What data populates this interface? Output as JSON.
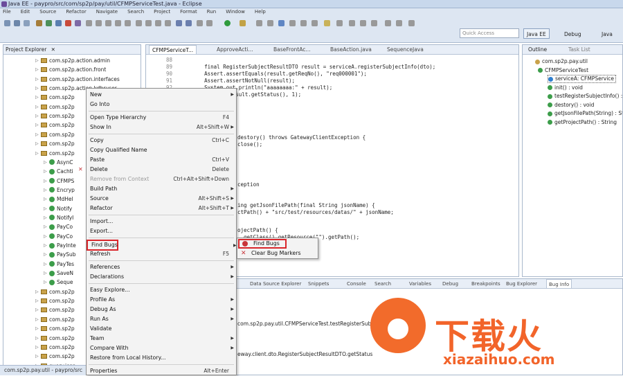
{
  "window": {
    "title": "Java EE - paypro/src/com/sp2p/pay/util/CFMPServiceTest.java - Eclipse"
  },
  "menubar": [
    "File",
    "Edit",
    "Source",
    "Refactor",
    "Navigate",
    "Search",
    "Project",
    "Format",
    "Run",
    "Window",
    "Help"
  ],
  "toolbar": {
    "quick_access_placeholder": "Quick Access",
    "perspectives": [
      "Java EE",
      "Debug",
      "Java"
    ]
  },
  "project_explorer": {
    "title": "Project Explorer",
    "items": [
      {
        "label": "com.sp2p.action.admin",
        "type": "package"
      },
      {
        "label": "com.sp2p.action.front",
        "type": "package"
      },
      {
        "label": "com.sp2p.action.interfaces",
        "type": "package"
      },
      {
        "label": "com.sp2p.action.kdbruser",
        "type": "package"
      },
      {
        "label": "com.sp2p",
        "type": "package"
      },
      {
        "label": "com.sp2p",
        "type": "package"
      },
      {
        "label": "com.sp2p",
        "type": "package"
      },
      {
        "label": "com.sp2p",
        "type": "package"
      },
      {
        "label": "com.sp2p",
        "type": "package"
      },
      {
        "label": "com.sp2p",
        "type": "package"
      },
      {
        "label": "com.sp2p",
        "type": "package"
      },
      {
        "label": "AsynC",
        "type": "class"
      },
      {
        "label": "Cachti",
        "type": "class"
      },
      {
        "label": "CFMPS",
        "type": "class"
      },
      {
        "label": "Encryp",
        "type": "class"
      },
      {
        "label": "MdHel",
        "type": "class"
      },
      {
        "label": "Notify",
        "type": "class"
      },
      {
        "label": "NotifyI",
        "type": "class"
      },
      {
        "label": "PayCo",
        "type": "class"
      },
      {
        "label": "PayCo",
        "type": "class"
      },
      {
        "label": "PayInte",
        "type": "class"
      },
      {
        "label": "PaySub",
        "type": "class"
      },
      {
        "label": "PayTes",
        "type": "class"
      },
      {
        "label": "SaveN",
        "type": "class"
      },
      {
        "label": "Seque",
        "type": "class"
      },
      {
        "label": "com.sp2p",
        "type": "package"
      },
      {
        "label": "com.sp2p",
        "type": "package"
      },
      {
        "label": "com.sp2p",
        "type": "package"
      },
      {
        "label": "com.sp2p",
        "type": "package"
      },
      {
        "label": "com.sp2p",
        "type": "package"
      },
      {
        "label": "com.sp2p",
        "type": "package"
      },
      {
        "label": "com.sp2p",
        "type": "package"
      },
      {
        "label": "com.sp2p",
        "type": "package"
      },
      {
        "label": "query.icgs",
        "type": "package"
      },
      {
        "label": "com.sp2p",
        "type": "package"
      }
    ]
  },
  "editor": {
    "tabs": [
      "CFMPServiceT...",
      "ApproveActi...",
      "BaseFrontAc...",
      "BaseAction.java",
      "SequenceJava"
    ],
    "lines": [
      {
        "n": "88",
        "text": ""
      },
      {
        "n": "89",
        "text": "        final RegisterSubjectResultDTO result = serviceA.registerSubjectInfo(dto);"
      },
      {
        "n": "90",
        "text": "        Assert.assertEquals(result.getReqNo(), \"req000001\");"
      },
      {
        "n": "91",
        "text": "        Assert.assertNotNull(result);"
      },
      {
        "n": "92",
        "text": "        System.out.println(\"aaaaaaaa:\" + result);"
      },
      {
        "n": "",
        "text": "        ...uals(result.getStatus(), 1);"
      }
    ],
    "fragments": [
      "destory() throws GatewayClientException {",
      "close();",
      "",
      "ception",
      "ing getJsonFilePath(final String jsonName) {",
      "ctPath() + \"src/test/resources/datas/\" + jsonName;",
      "ojectPath() {",
      "  getClass().getResource(\"\").getPath();",
      "  (\"CFMPServiceTest\", \"\");"
    ]
  },
  "outline": {
    "tabs": [
      "Outline",
      "Task List"
    ],
    "items": [
      {
        "label": "com.sp2p.pay.util",
        "kind": "package"
      },
      {
        "label": "CFMPServiceTest",
        "kind": "class"
      },
      {
        "label": "serviceA: CFMPService",
        "kind": "field"
      },
      {
        "label": "init() : void",
        "kind": "method"
      },
      {
        "label": "testRegisterSubjectInfo() :",
        "kind": "method"
      },
      {
        "label": "destory() : void",
        "kind": "method"
      },
      {
        "label": "getJsonFilePath(String) : St",
        "kind": "method"
      },
      {
        "label": "getProjectPath() : String",
        "kind": "method"
      }
    ]
  },
  "bottom_panel": {
    "tabs": [
      "Data Source Explorer",
      "Snippets",
      "Console",
      "Search",
      "Variables",
      "Debug",
      "Breakpoints",
      "Bug Explorer",
      "Bug Info"
    ],
    "lines": [
      "com.sp2p.pay.util.CFMPServiceTest.testRegisterSubject",
      "",
      "eway.client.dto.RegisterSubjectResultDTO.getStatus"
    ]
  },
  "context_menu": {
    "items": [
      {
        "label": "New",
        "shortcut": "",
        "submenu": true
      },
      {
        "label": "Go Into",
        "shortcut": ""
      },
      {
        "sep": true
      },
      {
        "label": "Open Type Hierarchy",
        "shortcut": "F4"
      },
      {
        "label": "Show In",
        "shortcut": "Alt+Shift+W",
        "submenu": true
      },
      {
        "sep": true
      },
      {
        "label": "Copy",
        "shortcut": "Ctrl+C"
      },
      {
        "label": "Copy Qualified Name",
        "shortcut": ""
      },
      {
        "label": "Paste",
        "shortcut": "Ctrl+V"
      },
      {
        "label": "Delete",
        "shortcut": "Delete"
      },
      {
        "label": "Remove from Context",
        "shortcut": "Ctrl+Alt+Shift+Down",
        "disabled": true
      },
      {
        "label": "Build Path",
        "shortcut": "",
        "submenu": true
      },
      {
        "label": "Source",
        "shortcut": "Alt+Shift+S",
        "submenu": true
      },
      {
        "label": "Refactor",
        "shortcut": "Alt+Shift+T",
        "submenu": true
      },
      {
        "sep": true
      },
      {
        "label": "Import...",
        "shortcut": ""
      },
      {
        "label": "Export...",
        "shortcut": ""
      },
      {
        "sep": true
      },
      {
        "label": "Find Bugs",
        "shortcut": "",
        "submenu": true,
        "highlight": true
      },
      {
        "label": "Refresh",
        "shortcut": "F5"
      },
      {
        "sep": true
      },
      {
        "label": "References",
        "shortcut": "",
        "submenu": true
      },
      {
        "label": "Declarations",
        "shortcut": "",
        "submenu": true
      },
      {
        "sep": true
      },
      {
        "label": "Easy Explore...",
        "shortcut": ""
      },
      {
        "label": "Profile As",
        "shortcut": "",
        "submenu": true
      },
      {
        "label": "Debug As",
        "shortcut": "",
        "submenu": true
      },
      {
        "label": "Run As",
        "shortcut": "",
        "submenu": true
      },
      {
        "label": "Validate",
        "shortcut": ""
      },
      {
        "label": "Team",
        "shortcut": "",
        "submenu": true
      },
      {
        "label": "Compare With",
        "shortcut": "",
        "submenu": true
      },
      {
        "label": "Restore from Local History...",
        "shortcut": ""
      },
      {
        "sep": true
      },
      {
        "label": "Properties",
        "shortcut": "Alt+Enter"
      }
    ]
  },
  "find_bugs_submenu": {
    "items": [
      "Find Bugs",
      "Clear Bug Markers"
    ]
  },
  "watermark": {
    "brand": "下载火",
    "url": "xiazaihuo.com"
  },
  "status": {
    "text": "com.sp2p.pay.util - paypro/src"
  },
  "colors": {
    "highlight_border": "#d9252a",
    "watermark": "#f2642a",
    "menu_bg": "#f3f3f3"
  }
}
